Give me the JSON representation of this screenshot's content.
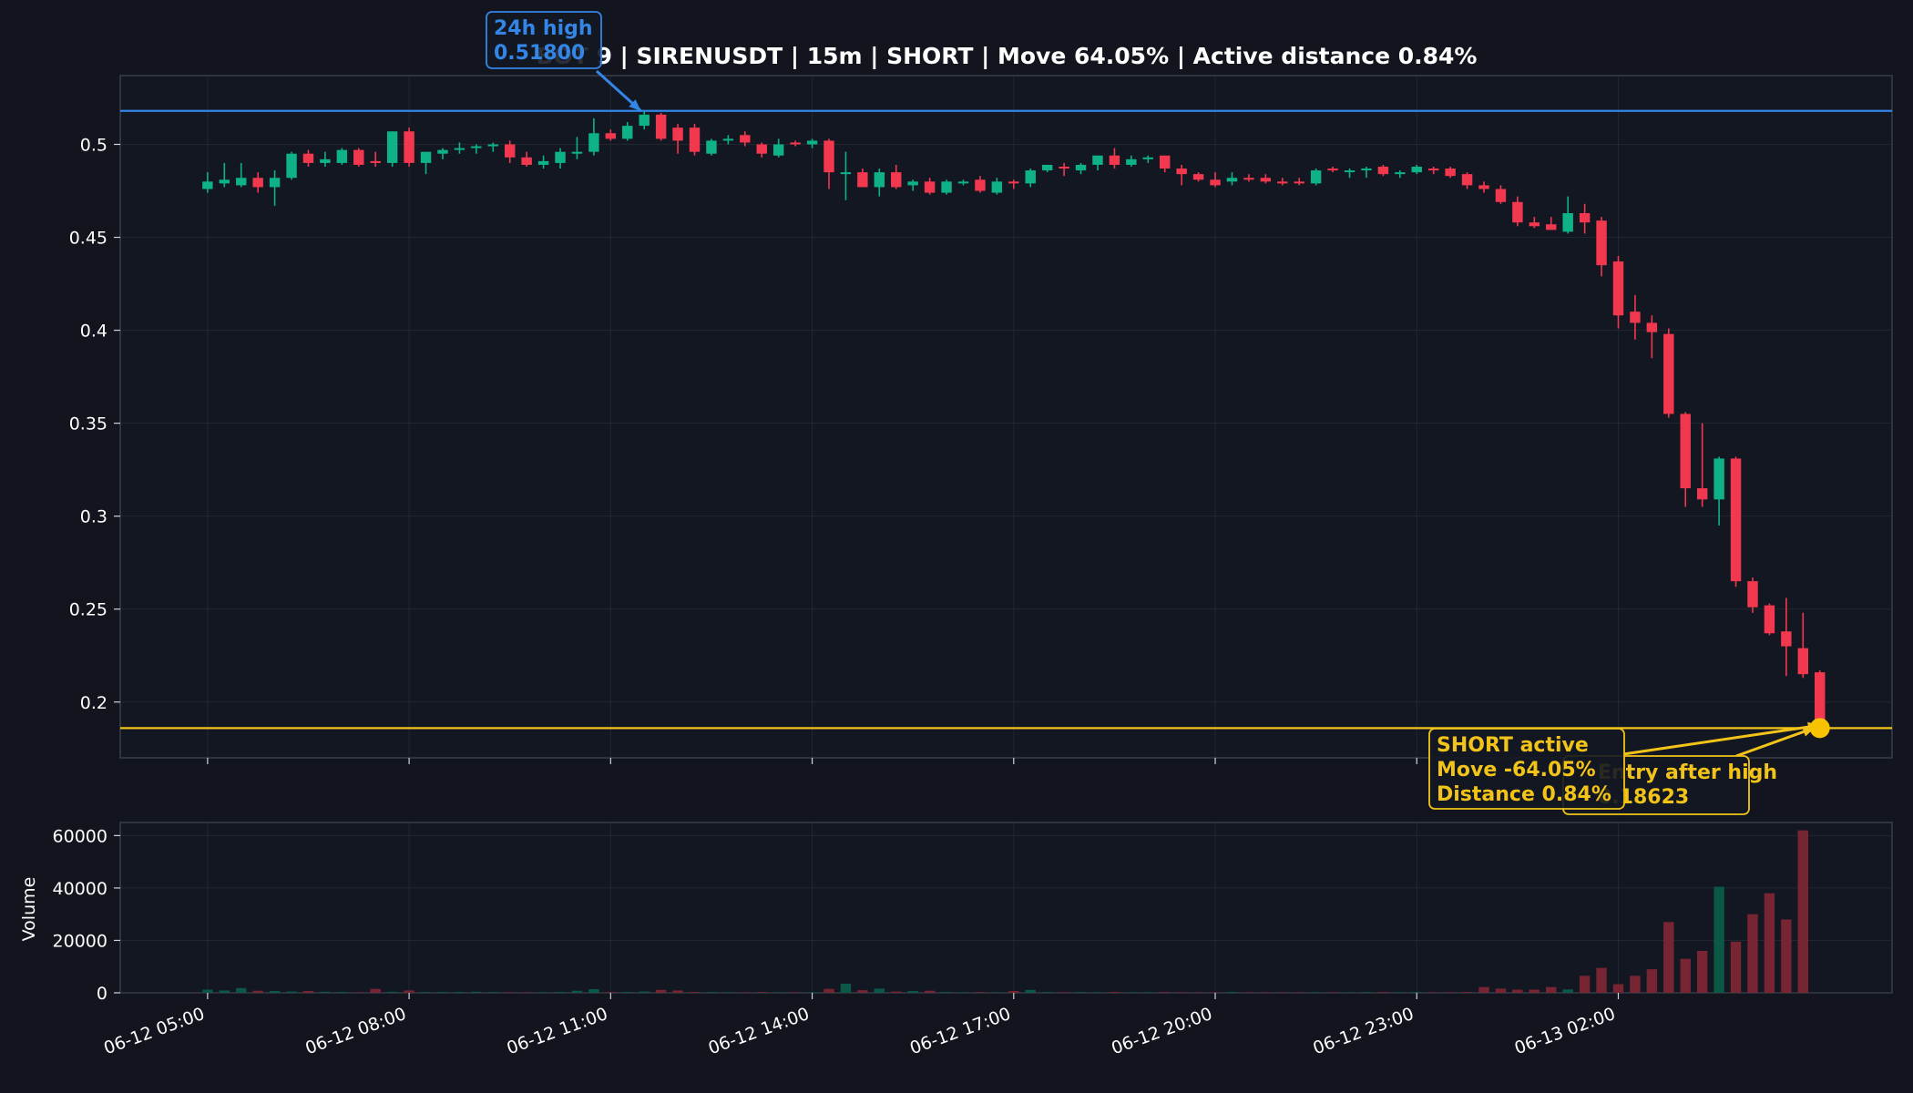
{
  "chart_data": {
    "type": "candlestick",
    "title": "BOT 9 | SIRENUSDT | 15m | SHORT | Move 64.05% | Active distance 0.84%",
    "xticks": [
      "06-12 05:00",
      "06-12 08:00",
      "06-12 11:00",
      "06-12 14:00",
      "06-12 17:00",
      "06-12 20:00",
      "06-12 23:00",
      "06-13 02:00"
    ],
    "price_axis": {
      "ticks": [
        0.2,
        0.25,
        0.3,
        0.35,
        0.4,
        0.45,
        0.5
      ],
      "tick_labels": [
        "0.2",
        "0.25",
        "0.3",
        "0.35",
        "0.4",
        "0.45",
        "0.5"
      ],
      "ylim": [
        0.17,
        0.537
      ]
    },
    "volume_axis": {
      "ylabel": "Volume",
      "ticks": [
        0,
        20000,
        40000,
        60000
      ],
      "tick_labels": [
        "0",
        "20000",
        "40000",
        "60000"
      ],
      "ylim": [
        0,
        65000
      ]
    },
    "x_range": [
      -5.2,
      100.3
    ],
    "candles": [
      [
        0.476,
        0.485,
        0.474,
        0.48,
        1200
      ],
      [
        0.479,
        0.49,
        0.477,
        0.481,
        900
      ],
      [
        0.478,
        0.49,
        0.477,
        0.482,
        1800
      ],
      [
        0.482,
        0.485,
        0.474,
        0.477,
        800
      ],
      [
        0.477,
        0.486,
        0.467,
        0.482,
        700
      ],
      [
        0.482,
        0.496,
        0.481,
        0.495,
        500
      ],
      [
        0.495,
        0.497,
        0.488,
        0.49,
        700
      ],
      [
        0.49,
        0.496,
        0.488,
        0.492,
        400
      ],
      [
        0.49,
        0.498,
        0.489,
        0.497,
        300
      ],
      [
        0.497,
        0.498,
        0.488,
        0.489,
        200
      ],
      [
        0.491,
        0.496,
        0.488,
        0.49,
        1500
      ],
      [
        0.49,
        0.507,
        0.488,
        0.507,
        400
      ],
      [
        0.507,
        0.509,
        0.488,
        0.49,
        900
      ],
      [
        0.49,
        0.496,
        0.484,
        0.496,
        300
      ],
      [
        0.495,
        0.498,
        0.492,
        0.497,
        300
      ],
      [
        0.497,
        0.501,
        0.495,
        0.498,
        300
      ],
      [
        0.498,
        0.5,
        0.495,
        0.499,
        400
      ],
      [
        0.499,
        0.501,
        0.496,
        0.5,
        300
      ],
      [
        0.5,
        0.502,
        0.49,
        0.493,
        200
      ],
      [
        0.493,
        0.496,
        0.488,
        0.489,
        200
      ],
      [
        0.489,
        0.494,
        0.487,
        0.491,
        200
      ],
      [
        0.49,
        0.498,
        0.487,
        0.496,
        300
      ],
      [
        0.495,
        0.504,
        0.492,
        0.496,
        800
      ],
      [
        0.496,
        0.514,
        0.494,
        0.506,
        1400
      ],
      [
        0.506,
        0.508,
        0.502,
        0.503,
        300
      ],
      [
        0.503,
        0.512,
        0.502,
        0.51,
        300
      ],
      [
        0.51,
        0.518,
        0.508,
        0.516,
        500
      ],
      [
        0.516,
        0.517,
        0.502,
        0.503,
        1100
      ],
      [
        0.509,
        0.511,
        0.495,
        0.502,
        900
      ],
      [
        0.509,
        0.511,
        0.494,
        0.496,
        300
      ],
      [
        0.495,
        0.503,
        0.494,
        0.502,
        300
      ],
      [
        0.502,
        0.505,
        0.5,
        0.503,
        200
      ],
      [
        0.505,
        0.507,
        0.499,
        0.501,
        200
      ],
      [
        0.5,
        0.501,
        0.493,
        0.495,
        300
      ],
      [
        0.494,
        0.503,
        0.493,
        0.5,
        200
      ],
      [
        0.501,
        0.502,
        0.499,
        0.5,
        200
      ],
      [
        0.5,
        0.503,
        0.498,
        0.502,
        200
      ],
      [
        0.502,
        0.503,
        0.476,
        0.485,
        1500
      ],
      [
        0.484,
        0.496,
        0.47,
        0.485,
        3500
      ],
      [
        0.485,
        0.487,
        0.477,
        0.477,
        1000
      ],
      [
        0.477,
        0.487,
        0.472,
        0.485,
        1600
      ],
      [
        0.485,
        0.489,
        0.476,
        0.477,
        500
      ],
      [
        0.478,
        0.481,
        0.475,
        0.48,
        700
      ],
      [
        0.48,
        0.482,
        0.473,
        0.474,
        800
      ],
      [
        0.474,
        0.481,
        0.473,
        0.48,
        300
      ],
      [
        0.479,
        0.481,
        0.478,
        0.48,
        200
      ],
      [
        0.481,
        0.483,
        0.474,
        0.475,
        300
      ],
      [
        0.474,
        0.482,
        0.473,
        0.48,
        200
      ],
      [
        0.48,
        0.481,
        0.476,
        0.479,
        700
      ],
      [
        0.479,
        0.487,
        0.477,
        0.486,
        1100
      ],
      [
        0.486,
        0.489,
        0.485,
        0.489,
        300
      ],
      [
        0.488,
        0.49,
        0.483,
        0.487,
        200
      ],
      [
        0.486,
        0.49,
        0.484,
        0.489,
        300
      ],
      [
        0.489,
        0.494,
        0.486,
        0.494,
        200
      ],
      [
        0.494,
        0.498,
        0.487,
        0.489,
        300
      ],
      [
        0.489,
        0.494,
        0.488,
        0.492,
        200
      ],
      [
        0.492,
        0.494,
        0.49,
        0.493,
        200
      ],
      [
        0.494,
        0.494,
        0.485,
        0.487,
        300
      ],
      [
        0.487,
        0.489,
        0.478,
        0.484,
        200
      ],
      [
        0.484,
        0.485,
        0.48,
        0.481,
        200
      ],
      [
        0.481,
        0.485,
        0.477,
        0.478,
        200
      ],
      [
        0.48,
        0.485,
        0.478,
        0.482,
        300
      ],
      [
        0.482,
        0.484,
        0.48,
        0.481,
        200
      ],
      [
        0.482,
        0.484,
        0.479,
        0.48,
        200
      ],
      [
        0.48,
        0.482,
        0.478,
        0.479,
        200
      ],
      [
        0.48,
        0.482,
        0.478,
        0.479,
        200
      ],
      [
        0.479,
        0.487,
        0.478,
        0.486,
        200
      ],
      [
        0.487,
        0.488,
        0.485,
        0.486,
        200
      ],
      [
        0.486,
        0.487,
        0.482,
        0.486,
        200
      ],
      [
        0.486,
        0.488,
        0.482,
        0.487,
        300
      ],
      [
        0.488,
        0.489,
        0.483,
        0.484,
        300
      ],
      [
        0.484,
        0.486,
        0.482,
        0.485,
        200
      ],
      [
        0.485,
        0.489,
        0.484,
        0.488,
        300
      ],
      [
        0.487,
        0.488,
        0.484,
        0.486,
        200
      ],
      [
        0.487,
        0.488,
        0.482,
        0.483,
        200
      ],
      [
        0.484,
        0.485,
        0.476,
        0.478,
        300
      ],
      [
        0.478,
        0.48,
        0.474,
        0.476,
        2200
      ],
      [
        0.476,
        0.478,
        0.468,
        0.469,
        1600
      ],
      [
        0.469,
        0.472,
        0.456,
        0.458,
        1200
      ],
      [
        0.458,
        0.461,
        0.455,
        0.456,
        1200
      ],
      [
        0.457,
        0.461,
        0.454,
        0.454,
        2200
      ],
      [
        0.453,
        0.472,
        0.452,
        0.463,
        1300
      ],
      [
        0.463,
        0.468,
        0.452,
        0.458,
        6500
      ],
      [
        0.459,
        0.461,
        0.429,
        0.435,
        9500
      ],
      [
        0.437,
        0.44,
        0.401,
        0.408,
        3300
      ],
      [
        0.41,
        0.419,
        0.395,
        0.404,
        6500
      ],
      [
        0.404,
        0.408,
        0.385,
        0.399,
        9000
      ],
      [
        0.398,
        0.401,
        0.353,
        0.355,
        27000
      ],
      [
        0.355,
        0.356,
        0.305,
        0.315,
        13000
      ],
      [
        0.315,
        0.35,
        0.305,
        0.309,
        16000
      ],
      [
        0.309,
        0.332,
        0.295,
        0.331,
        40500
      ],
      [
        0.331,
        0.332,
        0.262,
        0.265,
        19500
      ],
      [
        0.265,
        0.267,
        0.248,
        0.251,
        30000
      ],
      [
        0.252,
        0.253,
        0.236,
        0.237,
        38000
      ],
      [
        0.238,
        0.256,
        0.214,
        0.23,
        28000
      ],
      [
        0.229,
        0.248,
        0.213,
        0.215,
        62000
      ],
      [
        0.216,
        0.217,
        0.186,
        0.188,
        0
      ]
    ],
    "levels": [
      {
        "name": "24h high",
        "value": 0.518,
        "color": "#3385e6"
      },
      {
        "name": "Entry",
        "value": 0.186,
        "color": "#f2c318"
      }
    ],
    "annotations": [
      {
        "lines": [
          "24h high",
          "0.51800"
        ],
        "color": "#3385e6",
        "anchor_x": 25.8,
        "anchor_y": 0.518
      },
      {
        "lines": [
          "Entry after high",
          "0.18623"
        ],
        "color": "#f2c318",
        "anchor_x": 95.7,
        "anchor_y": 0.1862
      },
      {
        "lines": [
          "SHORT active",
          "Move -64.05%",
          "Distance 0.84%"
        ],
        "color": "#f2c318",
        "anchor_x": 96.0,
        "anchor_y": 0.1875
      }
    ],
    "marker": {
      "x": 96.0,
      "y": 0.186,
      "color": "#f7c300"
    },
    "colors": {
      "up": "#0fb187",
      "down": "#f2384f",
      "grid": "#2b303b",
      "text": "#ffffff"
    },
    "grid": true
  }
}
